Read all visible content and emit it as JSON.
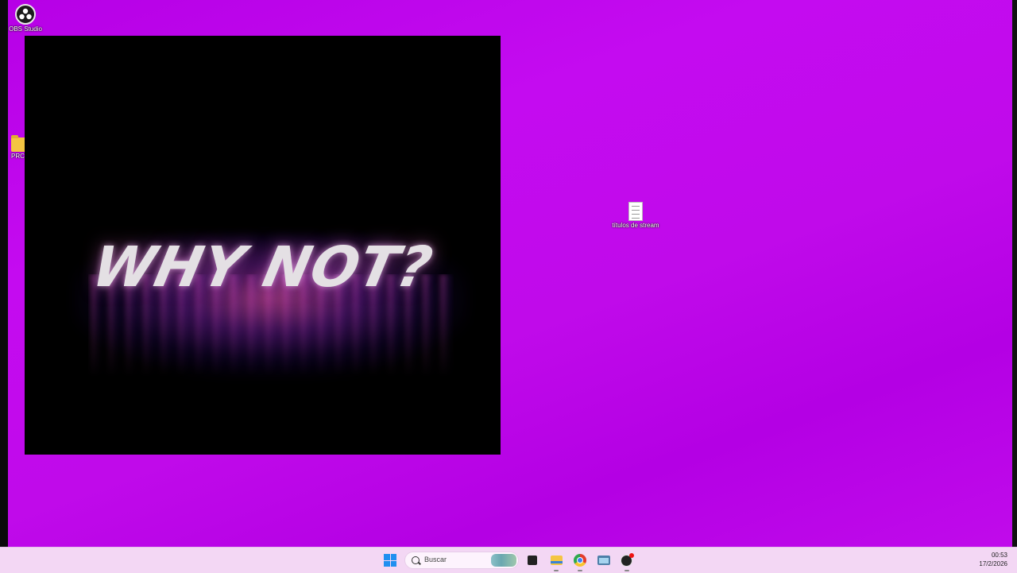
{
  "desktop": {
    "icons": [
      {
        "label": "OBS Studio",
        "icon": "obs-studio-icon"
      },
      {
        "label": "PRC",
        "icon": "folder-icon"
      },
      {
        "label": "títulos de stream",
        "icon": "text-document-icon"
      }
    ],
    "background_color": "#c00aea"
  },
  "video_window": {
    "text": "WHY NOT?"
  },
  "taskbar": {
    "search_placeholder": "Buscar",
    "apps": [
      "start-icon",
      "task-view-icon",
      "file-explorer-icon",
      "chrome-icon",
      "window-app-icon",
      "obs-studio-icon"
    ],
    "time": "00:53",
    "date": "17/2/2026"
  }
}
